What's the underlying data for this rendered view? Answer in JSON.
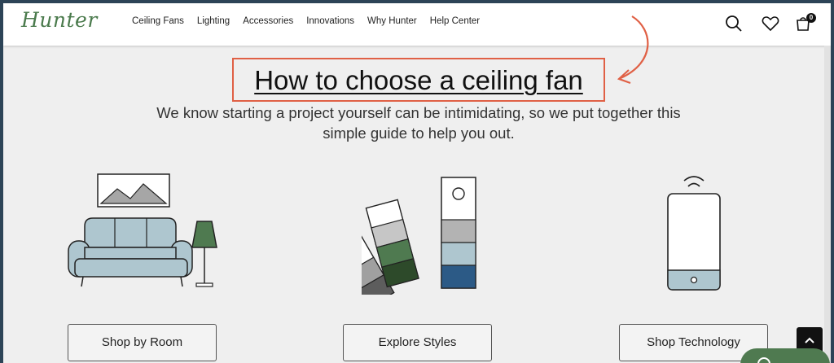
{
  "brand": {
    "logo_text": "Hunter",
    "color": "#4a7a4c"
  },
  "nav": {
    "items": [
      "Ceiling Fans",
      "Lighting",
      "Accessories",
      "Innovations",
      "Why Hunter",
      "Help Center"
    ],
    "icons": [
      "search-icon",
      "heart-icon",
      "cart-icon"
    ],
    "cart_count": "0"
  },
  "hero": {
    "title": "How to choose a ceiling fan",
    "subtitle": "We know starting a project yourself can be intimidating, so we put together this simple guide to help you out."
  },
  "cards": [
    {
      "button": "Shop by Room",
      "icon": "living-room-illustration"
    },
    {
      "button": "Explore Styles",
      "icon": "color-swatch-illustration"
    },
    {
      "button": "Shop Technology",
      "icon": "smartphone-illustration"
    }
  ],
  "colors": {
    "annotation": "#e06045",
    "background": "#efefef",
    "frame": "#2d4457"
  }
}
